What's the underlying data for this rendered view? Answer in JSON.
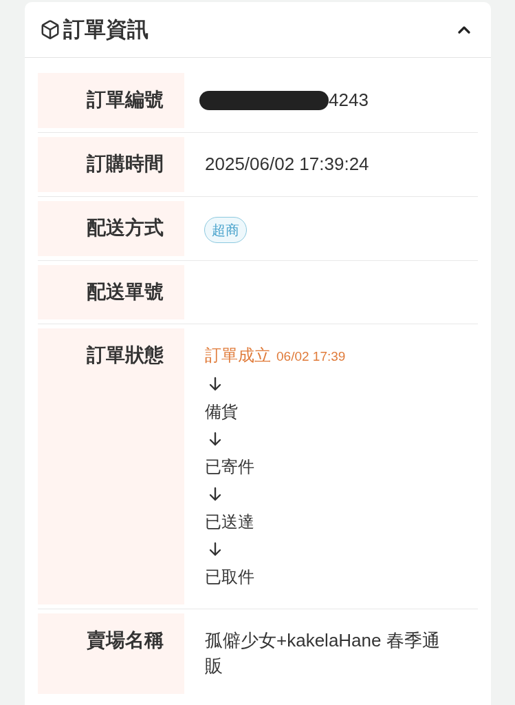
{
  "panel": {
    "title": "訂單資訊",
    "expanded": true
  },
  "rows": [
    {
      "kind": "text",
      "label": "訂單編號",
      "value": "4243",
      "redacted": true
    },
    {
      "kind": "text",
      "label": "訂購時間",
      "value": "2025/06/02 17:39:24",
      "redacted": false
    },
    {
      "kind": "badge",
      "label": "配送方式",
      "value": "超商"
    },
    {
      "kind": "empty",
      "label": "配送單號"
    },
    {
      "kind": "timeline",
      "label": "訂單狀態",
      "steps": [
        {
          "name": "訂單成立",
          "time": "06/02 17:39",
          "current": true
        },
        {
          "name": "備貨",
          "current": false
        },
        {
          "name": "已寄件",
          "current": false
        },
        {
          "name": "已送達",
          "current": false
        },
        {
          "name": "已取件",
          "current": false
        }
      ]
    },
    {
      "kind": "text",
      "label": "賣場名稱",
      "value": "孤僻少女+kakelaHane 春季通販",
      "redacted": false
    }
  ]
}
